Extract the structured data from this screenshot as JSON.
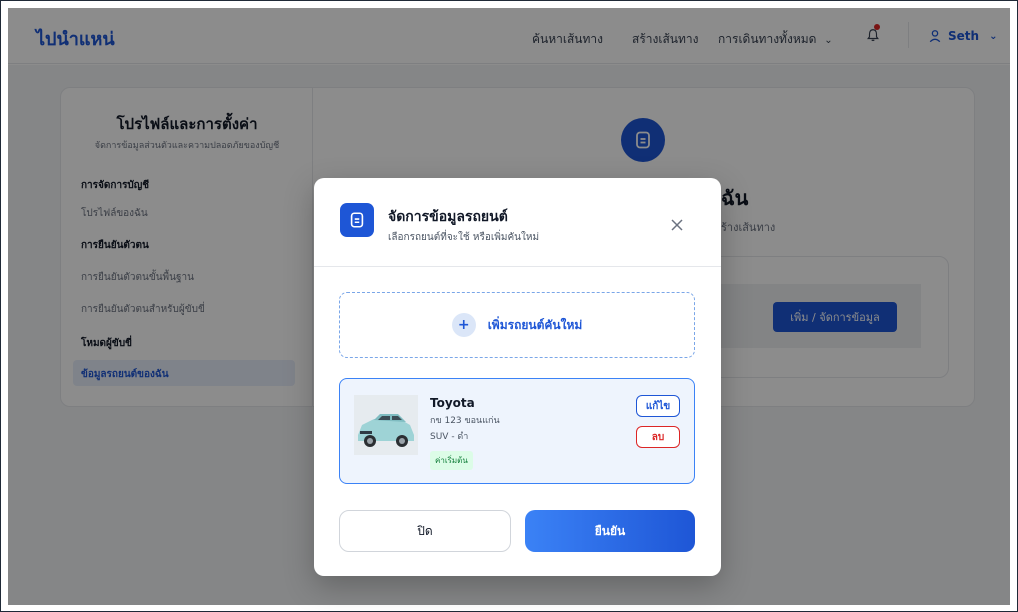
{
  "app": {
    "brand": "ไปนำแหน่"
  },
  "nav": {
    "search_route": "ค้นหาเส้นทาง",
    "create_route": "สร้างเส้นทาง",
    "all_trips": "การเดินทางทั้งหมด",
    "user_name": "Seth"
  },
  "sidebar": {
    "title": "โปรไฟล์และการตั้งค่า",
    "subtitle": "จัดการข้อมูลส่วนตัวและความปลอดภัยของบัญชี",
    "groups": [
      {
        "label": "การจัดการบัญชี",
        "items": [
          {
            "label": "โปรไฟล์ของฉัน"
          }
        ]
      },
      {
        "label": "การยืนยันตัวตน",
        "items": [
          {
            "label": "การยืนยันตัวตนขั้นพื้นฐาน"
          },
          {
            "label": "การยืนยันตัวตนสำหรับผู้ขับขี่"
          }
        ]
      },
      {
        "label": "โหมดผู้ขับขี่",
        "items": [
          {
            "label": "ข้อมูลรถยนต์ของฉัน"
          }
        ]
      }
    ]
  },
  "main": {
    "heading_partial": "ฉัน",
    "sub_partial": "ร้างเส้นทาง",
    "manage_button": "เพิ่ม / จัดการข้อมูล"
  },
  "modal": {
    "title": "จัดการข้อมูลรถยนต์",
    "subtitle": "เลือกรถยนต์ที่จะใช้ หรือเพิ่มคันใหม่",
    "add_label": "เพิ่มรถยนต์คันใหม่",
    "car": {
      "name": "Toyota",
      "plate": "กข 123 ขอนแก่น",
      "type": "SUV - ดำ",
      "badge": "ค่าเริ่มต้น",
      "edit_label": "แก้ไข",
      "delete_label": "ลบ"
    },
    "close_label": "ปิด",
    "confirm_label": "ยืนยัน"
  },
  "colors": {
    "accent": "#1e56d6",
    "danger": "#dc2626",
    "success_bg": "#dcfce7",
    "success_text": "#15803d"
  },
  "icons": {
    "document": "document-icon",
    "bell": "bell-icon",
    "user": "user-icon",
    "chevron": "chevron-down-icon",
    "close": "close-icon",
    "plus": "plus-icon"
  }
}
